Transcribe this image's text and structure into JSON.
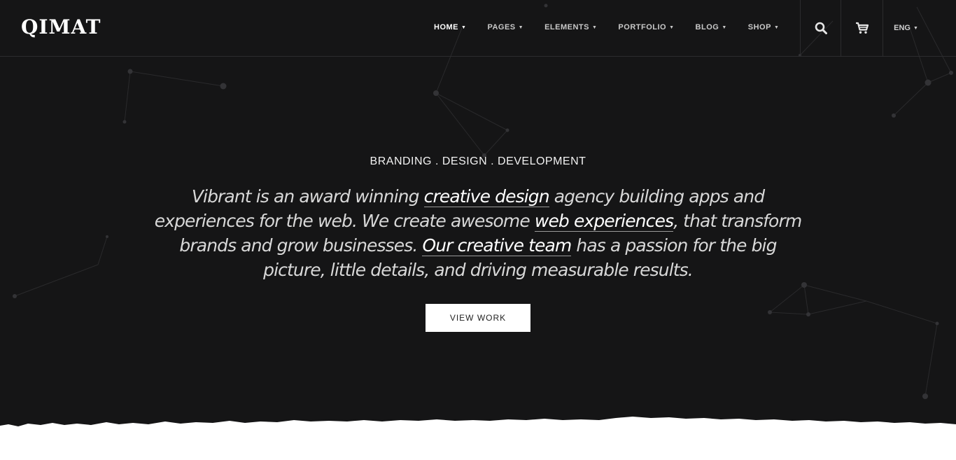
{
  "brand": {
    "logo": "QIMAT"
  },
  "nav": {
    "items": [
      {
        "label": "HOME",
        "icon": "chevron-down-icon",
        "active": true
      },
      {
        "label": "PAGES",
        "icon": "chevron-down-icon"
      },
      {
        "label": "ELEMENTS",
        "icon": "chevron-down-icon"
      },
      {
        "label": "PORTFOLIO",
        "icon": "chevron-down-icon"
      },
      {
        "label": "BLOG",
        "icon": "chevron-down-icon"
      },
      {
        "label": "SHOP",
        "icon": "chevron-down-icon"
      }
    ],
    "search_icon": "search-icon",
    "cart_icon": "cart-icon",
    "language": "ENG"
  },
  "hero": {
    "tagline": "BRANDING . DESIGN . DEVELOPMENT",
    "intro": {
      "part1": "Vibrant is an award winning ",
      "link1": "creative design",
      "part2": " agency building apps and experiences for the web. We create awesome ",
      "link2": "web experiences",
      "part3": ", that transform brands and grow businesses. ",
      "link3": "Our creative team",
      "part4": " has a passion for the big picture, little details, and driving measurable results."
    },
    "cta_label": "VIEW WORK"
  },
  "colors": {
    "hero_background": "#151516",
    "text_white": "#ffffff",
    "button_background": "#ffffff",
    "page_background": "#ffffff"
  }
}
